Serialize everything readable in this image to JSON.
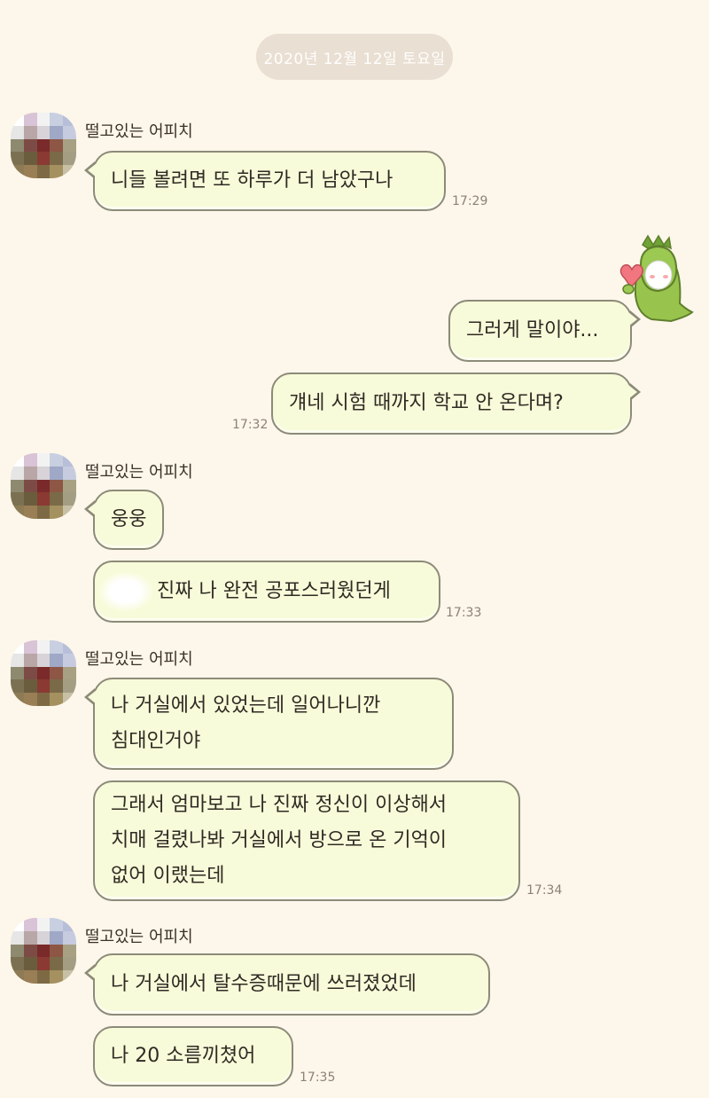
{
  "date_divider": "2020년 12월 12일 토요일",
  "sender_name": "떨고있는 어피치",
  "groups": [
    {
      "name": "떨고있는 어피치",
      "messages": [
        {
          "lines": [
            "니들 볼려면 또 하루가 더 남았구나"
          ],
          "time": "17:29"
        }
      ]
    },
    {
      "mine": true,
      "messages": [
        {
          "lines": [
            "그러게 말이야..."
          ]
        },
        {
          "lines": [
            "걔네 시험 때까지 학교 안 온다며?"
          ],
          "time": "17:32"
        }
      ]
    },
    {
      "name": "떨고있는 어피치",
      "messages": [
        {
          "lines": [
            "웅웅"
          ]
        },
        {
          "lines": [
            "진짜 나 완전 공포스러웠던게"
          ],
          "time": "17:33"
        }
      ]
    },
    {
      "name": "떨고있는 어피치",
      "messages": [
        {
          "lines": [
            "나 거실에서 있었는데 일어나니깐",
            "침대인거야"
          ]
        },
        {
          "lines": [
            "그래서 엄마보고 나 진짜 정신이 이상해서",
            "치매 걸렸나봐 거실에서 방으로 온 기억이",
            "없어 이랬는데"
          ],
          "time": "17:34"
        }
      ]
    },
    {
      "name": "떨고있는 어피치",
      "messages": [
        {
          "lines": [
            "나 거실에서 탈수증때문에 쓰러졌었데"
          ]
        },
        {
          "lines": [
            "나 20 소름끼쳤어"
          ],
          "time": "17:35"
        }
      ]
    }
  ],
  "sticker": "dinosaur-costume-heart-sticker",
  "colors": {
    "background": "#fdf6ea",
    "bubble": "#f8fbd9",
    "bubble_border": "#8c8a79",
    "date_pill": "#e9dfd2"
  }
}
